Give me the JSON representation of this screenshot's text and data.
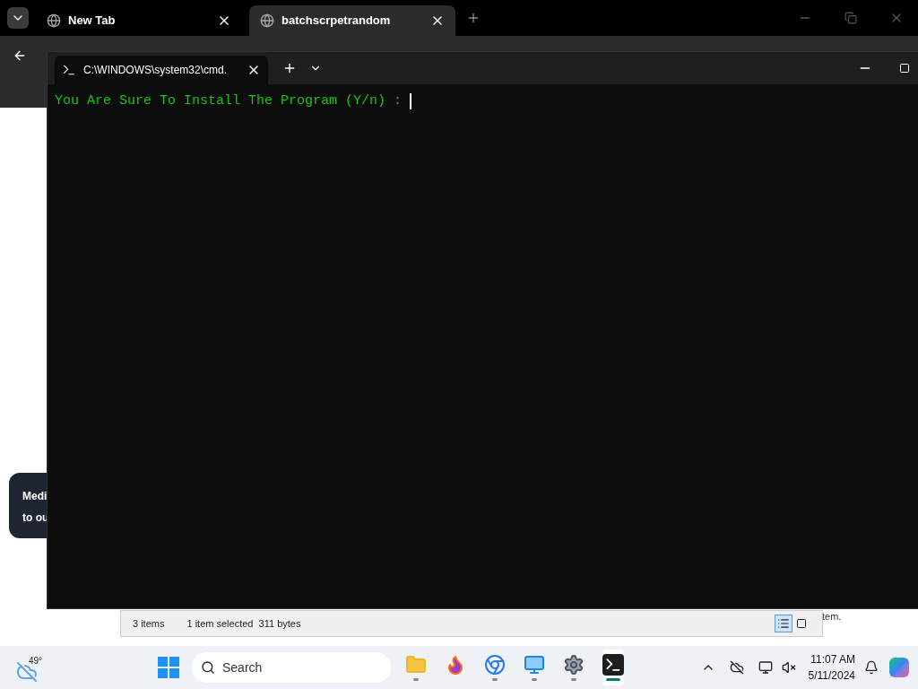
{
  "browser": {
    "tabs": [
      {
        "title": "New Tab",
        "selected": false
      },
      {
        "title": "batchscrpetrandom",
        "selected": true
      }
    ],
    "page": {
      "toast_lines": [
        "Medi",
        "to ou"
      ],
      "side_text": "tem."
    }
  },
  "terminal": {
    "tab_title": "C:\\WINDOWS\\system32\\cmd.",
    "prompt": "You Are Sure To Install The Program (Y/n) : "
  },
  "explorer_status": {
    "items": "3 items",
    "selection": "1 item selected  311 bytes",
    "views": [
      {
        "kind": "details",
        "selected": true
      },
      {
        "kind": "tiles",
        "selected": false
      }
    ]
  },
  "taskbar": {
    "temperature": "49°",
    "search_placeholder": "Search",
    "apps": [
      {
        "kind": "folder",
        "running": true,
        "active": false
      },
      {
        "kind": "firefox",
        "running": false,
        "active": false
      },
      {
        "kind": "chrome",
        "running": true,
        "active": false
      },
      {
        "kind": "monitor",
        "running": true,
        "active": false
      },
      {
        "kind": "settings",
        "running": true,
        "active": false
      },
      {
        "kind": "terminal",
        "running": true,
        "active": true
      }
    ],
    "time": "11:07 AM",
    "date": "5/11/2024"
  }
}
